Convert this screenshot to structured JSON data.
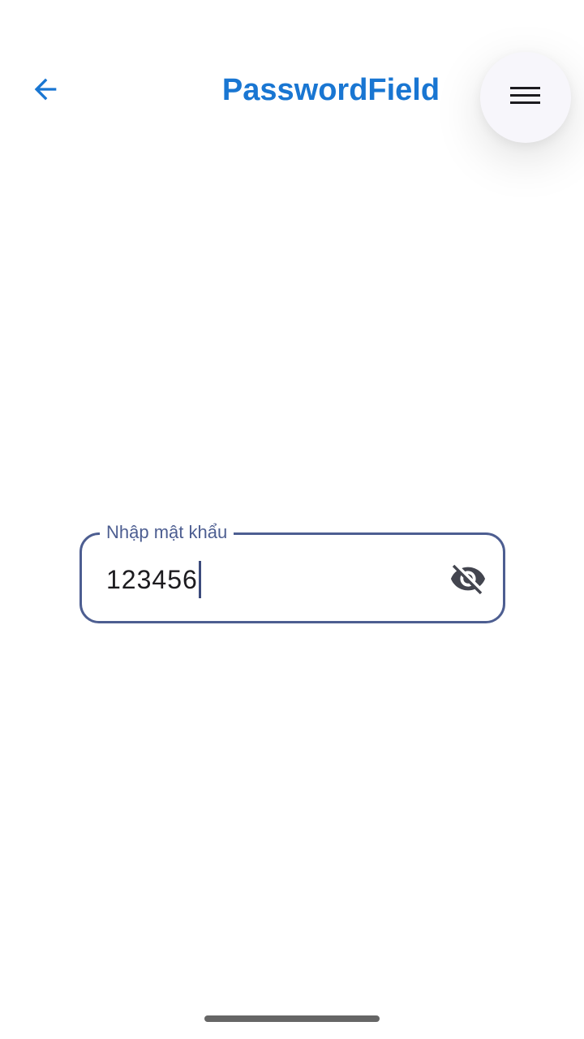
{
  "app_bar": {
    "title": "PasswordField",
    "back_icon": "arrow-back-icon",
    "menu_icon": "menu-icon",
    "title_color": "#1976d2"
  },
  "password_field": {
    "label": "Nhập mật khẩu",
    "value": "123456",
    "toggle_icon": "visibility-off-icon",
    "accent_color": "#4d5e91"
  }
}
